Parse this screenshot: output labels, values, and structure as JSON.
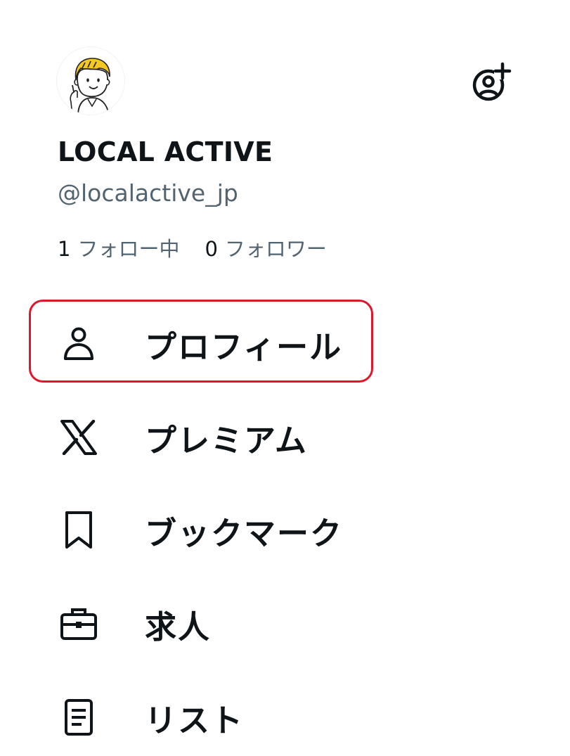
{
  "profile": {
    "display_name": "LOCAL ACTIVE",
    "handle": "@localactive_jp",
    "avatar_icon": "cartoon-avatar",
    "following_count": "1",
    "following_label": "フォロー中",
    "followers_count": "0",
    "followers_label": "フォロワー"
  },
  "header": {
    "add_account_icon": "add-account-icon"
  },
  "menu": {
    "items": [
      {
        "icon": "person-icon",
        "label": "プロフィール",
        "highlighted": true
      },
      {
        "icon": "x-logo-icon",
        "label": "プレミアム"
      },
      {
        "icon": "bookmark-icon",
        "label": "ブックマーク"
      },
      {
        "icon": "briefcase-icon",
        "label": "求人"
      },
      {
        "icon": "list-icon",
        "label": "リスト"
      }
    ]
  },
  "colors": {
    "text_primary": "#0f1419",
    "text_secondary": "#536471",
    "highlight": "#e0162b",
    "avatar_hair": "#f6c824"
  }
}
